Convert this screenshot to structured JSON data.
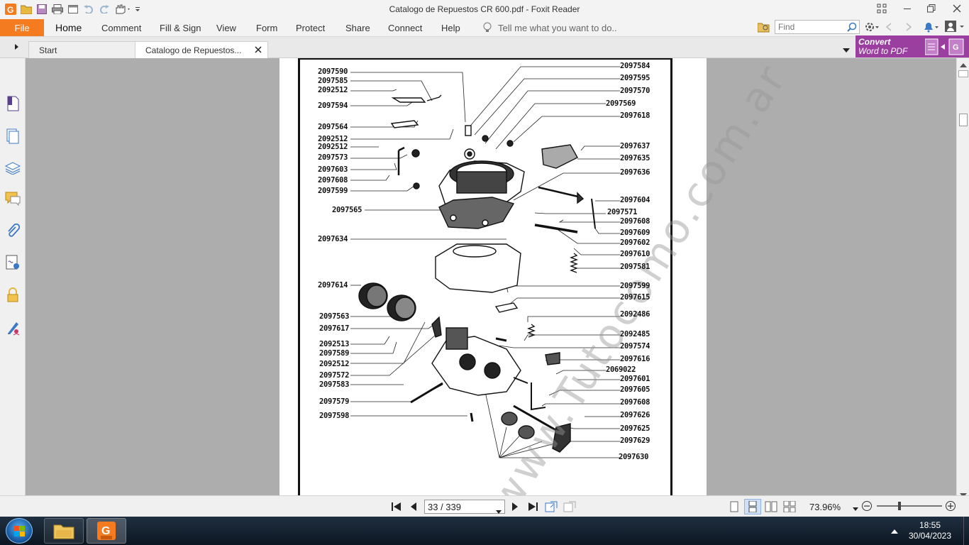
{
  "app": {
    "title": "Catalogo de Repuestos CR 600.pdf - Foxit Reader"
  },
  "ribbon": {
    "file": "File",
    "tabs": [
      "Home",
      "Comment",
      "Fill & Sign",
      "View",
      "Form",
      "Protect",
      "Share",
      "Connect",
      "Help"
    ],
    "tell_me": "Tell me what you want to do..",
    "find_placeholder": "Find"
  },
  "doc_tabs": {
    "start": "Start",
    "current": "Catalogo de Repuestos..."
  },
  "ad": {
    "line1": "Convert",
    "line2": "Word to PDF"
  },
  "diagram": {
    "left_labels": [
      "2097590",
      "2097585",
      "2092512",
      "2097594",
      "2097564",
      "2092512",
      "2092512",
      "2097573",
      "2097603",
      "2097608",
      "2097599",
      "2097565",
      "2097634",
      "2097614",
      "2097563",
      "2097617",
      "2092513",
      "2097589",
      "2092512",
      "2097572",
      "2097583",
      "2097579",
      "2097598"
    ],
    "right_labels": [
      "2097584",
      "2097595",
      "2097570",
      "2097569",
      "2097618",
      "2097637",
      "2097635",
      "2097636",
      "2097604",
      "2097571",
      "2097608",
      "2097609",
      "2097602",
      "2097610",
      "2097581",
      "2097599",
      "2097615",
      "2092486",
      "2092485",
      "2097574",
      "2097616",
      "2069022",
      "2097601",
      "2097605",
      "2097608",
      "2097626",
      "2097625",
      "2097629",
      "2097630"
    ],
    "watermark": "www.Tutocomo.com.ar"
  },
  "status": {
    "page": "33 / 339",
    "zoom": "73.96%"
  },
  "taskbar": {
    "time": "18:55",
    "date": "30/04/2023"
  }
}
